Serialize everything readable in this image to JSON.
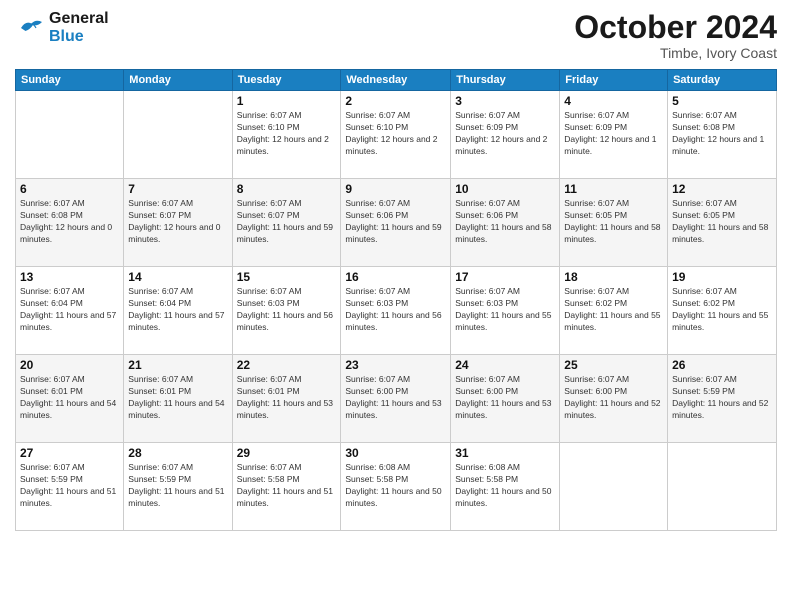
{
  "logo": {
    "line1": "General",
    "line2": "Blue"
  },
  "header": {
    "month": "October 2024",
    "location": "Timbe, Ivory Coast"
  },
  "days_of_week": [
    "Sunday",
    "Monday",
    "Tuesday",
    "Wednesday",
    "Thursday",
    "Friday",
    "Saturday"
  ],
  "weeks": [
    [
      {
        "day": "",
        "info": ""
      },
      {
        "day": "",
        "info": ""
      },
      {
        "day": "1",
        "info": "Sunrise: 6:07 AM\nSunset: 6:10 PM\nDaylight: 12 hours and 2 minutes."
      },
      {
        "day": "2",
        "info": "Sunrise: 6:07 AM\nSunset: 6:10 PM\nDaylight: 12 hours and 2 minutes."
      },
      {
        "day": "3",
        "info": "Sunrise: 6:07 AM\nSunset: 6:09 PM\nDaylight: 12 hours and 2 minutes."
      },
      {
        "day": "4",
        "info": "Sunrise: 6:07 AM\nSunset: 6:09 PM\nDaylight: 12 hours and 1 minute."
      },
      {
        "day": "5",
        "info": "Sunrise: 6:07 AM\nSunset: 6:08 PM\nDaylight: 12 hours and 1 minute."
      }
    ],
    [
      {
        "day": "6",
        "info": "Sunrise: 6:07 AM\nSunset: 6:08 PM\nDaylight: 12 hours and 0 minutes."
      },
      {
        "day": "7",
        "info": "Sunrise: 6:07 AM\nSunset: 6:07 PM\nDaylight: 12 hours and 0 minutes."
      },
      {
        "day": "8",
        "info": "Sunrise: 6:07 AM\nSunset: 6:07 PM\nDaylight: 11 hours and 59 minutes."
      },
      {
        "day": "9",
        "info": "Sunrise: 6:07 AM\nSunset: 6:06 PM\nDaylight: 11 hours and 59 minutes."
      },
      {
        "day": "10",
        "info": "Sunrise: 6:07 AM\nSunset: 6:06 PM\nDaylight: 11 hours and 58 minutes."
      },
      {
        "day": "11",
        "info": "Sunrise: 6:07 AM\nSunset: 6:05 PM\nDaylight: 11 hours and 58 minutes."
      },
      {
        "day": "12",
        "info": "Sunrise: 6:07 AM\nSunset: 6:05 PM\nDaylight: 11 hours and 58 minutes."
      }
    ],
    [
      {
        "day": "13",
        "info": "Sunrise: 6:07 AM\nSunset: 6:04 PM\nDaylight: 11 hours and 57 minutes."
      },
      {
        "day": "14",
        "info": "Sunrise: 6:07 AM\nSunset: 6:04 PM\nDaylight: 11 hours and 57 minutes."
      },
      {
        "day": "15",
        "info": "Sunrise: 6:07 AM\nSunset: 6:03 PM\nDaylight: 11 hours and 56 minutes."
      },
      {
        "day": "16",
        "info": "Sunrise: 6:07 AM\nSunset: 6:03 PM\nDaylight: 11 hours and 56 minutes."
      },
      {
        "day": "17",
        "info": "Sunrise: 6:07 AM\nSunset: 6:03 PM\nDaylight: 11 hours and 55 minutes."
      },
      {
        "day": "18",
        "info": "Sunrise: 6:07 AM\nSunset: 6:02 PM\nDaylight: 11 hours and 55 minutes."
      },
      {
        "day": "19",
        "info": "Sunrise: 6:07 AM\nSunset: 6:02 PM\nDaylight: 11 hours and 55 minutes."
      }
    ],
    [
      {
        "day": "20",
        "info": "Sunrise: 6:07 AM\nSunset: 6:01 PM\nDaylight: 11 hours and 54 minutes."
      },
      {
        "day": "21",
        "info": "Sunrise: 6:07 AM\nSunset: 6:01 PM\nDaylight: 11 hours and 54 minutes."
      },
      {
        "day": "22",
        "info": "Sunrise: 6:07 AM\nSunset: 6:01 PM\nDaylight: 11 hours and 53 minutes."
      },
      {
        "day": "23",
        "info": "Sunrise: 6:07 AM\nSunset: 6:00 PM\nDaylight: 11 hours and 53 minutes."
      },
      {
        "day": "24",
        "info": "Sunrise: 6:07 AM\nSunset: 6:00 PM\nDaylight: 11 hours and 53 minutes."
      },
      {
        "day": "25",
        "info": "Sunrise: 6:07 AM\nSunset: 6:00 PM\nDaylight: 11 hours and 52 minutes."
      },
      {
        "day": "26",
        "info": "Sunrise: 6:07 AM\nSunset: 5:59 PM\nDaylight: 11 hours and 52 minutes."
      }
    ],
    [
      {
        "day": "27",
        "info": "Sunrise: 6:07 AM\nSunset: 5:59 PM\nDaylight: 11 hours and 51 minutes."
      },
      {
        "day": "28",
        "info": "Sunrise: 6:07 AM\nSunset: 5:59 PM\nDaylight: 11 hours and 51 minutes."
      },
      {
        "day": "29",
        "info": "Sunrise: 6:07 AM\nSunset: 5:58 PM\nDaylight: 11 hours and 51 minutes."
      },
      {
        "day": "30",
        "info": "Sunrise: 6:08 AM\nSunset: 5:58 PM\nDaylight: 11 hours and 50 minutes."
      },
      {
        "day": "31",
        "info": "Sunrise: 6:08 AM\nSunset: 5:58 PM\nDaylight: 11 hours and 50 minutes."
      },
      {
        "day": "",
        "info": ""
      },
      {
        "day": "",
        "info": ""
      }
    ]
  ]
}
